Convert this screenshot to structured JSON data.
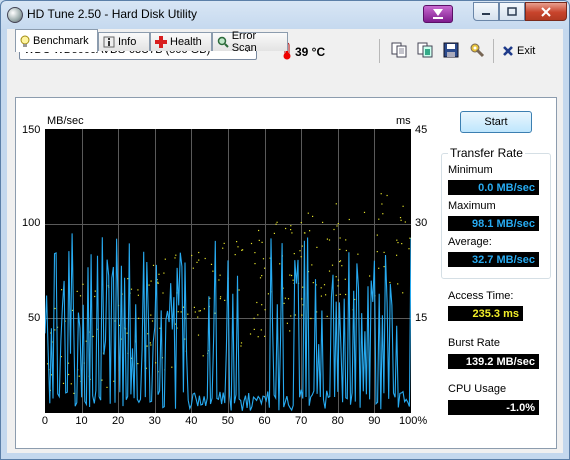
{
  "window": {
    "title": "HD Tune 2.50 - Hard Disk Utility"
  },
  "toolbar": {
    "drive": "WDC WD5000AVDS-63U7B (500 GB)",
    "temperature": "39 °C",
    "exit_label": "Exit"
  },
  "tabs": [
    {
      "label": "Benchmark",
      "icon": "bulb-icon",
      "active": true
    },
    {
      "label": "Info",
      "icon": "info-icon"
    },
    {
      "label": "Health",
      "icon": "health-cross-icon"
    },
    {
      "label": "Error Scan",
      "icon": "magnifier-icon"
    }
  ],
  "chart": {
    "left_unit": "MB/sec",
    "right_unit": "ms",
    "y_left_ticks": [
      "150",
      "100",
      "50"
    ],
    "y_right_ticks": [
      "45",
      "30",
      "15"
    ],
    "x_ticks": [
      "0",
      "10",
      "20",
      "30",
      "40",
      "50",
      "60",
      "70",
      "80",
      "90",
      "100%"
    ],
    "colors": {
      "transfer": "#27aaf0",
      "access": "#e3e12a",
      "grid": "#5a5a5a",
      "background": "#000000"
    }
  },
  "chart_data": {
    "type": "line",
    "xlabel": "",
    "ylabel": "MB/sec",
    "y2label": "ms",
    "xlim": [
      0,
      100
    ],
    "ylim": [
      0,
      150
    ],
    "y2lim": [
      0,
      45
    ],
    "grid": true,
    "series": [],
    "note_values": {
      "transfer_min_mbps": 0.0,
      "transfer_max_mbps": 98.1,
      "transfer_avg_mbps": 32.7,
      "access_time_ms": 235.3
    }
  },
  "side": {
    "start_label": "Start",
    "transfer_rate_title": "Transfer Rate",
    "minimum_label": "Minimum",
    "minimum_value": "0.0 MB/sec",
    "maximum_label": "Maximum",
    "maximum_value": "98.1 MB/sec",
    "average_label": "Average:",
    "average_value": "32.7 MB/sec",
    "access_time_label": "Access Time:",
    "access_time_value": "235.3 ms",
    "burst_rate_label": "Burst Rate",
    "burst_rate_value": "139.2 MB/sec",
    "cpu_usage_label": "CPU Usage",
    "cpu_usage_value": "-1.0%",
    "colors": {
      "transfer_text": "#27aaf0",
      "access_text": "#f2ee2a",
      "plain_text": "#ffffff"
    }
  }
}
